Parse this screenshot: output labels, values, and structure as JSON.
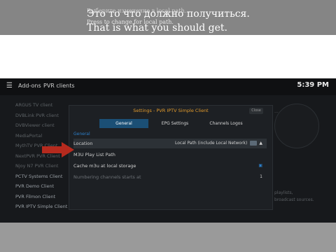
{
  "caption": {
    "ghost_line": "Выберите изменение в local path...",
    "russian_line": "Это то что должно получиться.",
    "subtitle": "Press to change for local path.",
    "english_line": "That is what you should get."
  },
  "header": {
    "breadcrumb_1": "Add-ons",
    "breadcrumb_2": "PVR clients",
    "clock": "5:39 PM"
  },
  "left_list": [
    "ARGUS TV client",
    "DVBLink PVR client",
    "DVBViewer client",
    "MediaPortal",
    "MythTV PVR Client",
    "NextPVR PVR Client",
    "Njoy N7 PVR Client",
    "PCTV Systems Client",
    "PVR Demo Client",
    "PVR Filmon Client",
    "PVR IPTV Simple Client"
  ],
  "dialog": {
    "title": "Settings - PVR IPTV Simple Client",
    "tabs": [
      "General",
      "EPG Settings",
      "Channels Logos"
    ],
    "section": "General",
    "location_label": "Location",
    "location_value": "Local Path (include Local Network)",
    "m3u_label": "M3U Play List Path",
    "cache_label": "Cache m3u at local storage",
    "numbering_label": "Numbering channels starts at",
    "numbering_value": "1",
    "close_label": "Close"
  },
  "right_pane": {
    "line1": "...",
    "line2": "playlists,",
    "line3": "broadcast sources."
  },
  "colors": {
    "accent_orange": "#e39b2c",
    "accent_blue": "#1b4f75",
    "arrow_red": "#b52a1e"
  }
}
